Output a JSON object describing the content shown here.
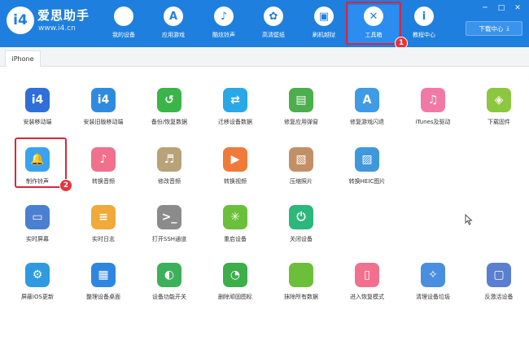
{
  "app": {
    "brand": "爱思助手",
    "url": "www.i4.cn",
    "logo_mark": "i4"
  },
  "nav": {
    "items": [
      {
        "label": "我的设备",
        "icon": "apple-icon",
        "glyph": ""
      },
      {
        "label": "应用游戏",
        "icon": "app-store-icon",
        "glyph": "A"
      },
      {
        "label": "酷炫铃声",
        "icon": "bell-icon",
        "glyph": "♪"
      },
      {
        "label": "高清壁纸",
        "icon": "flower-icon",
        "glyph": "✿"
      },
      {
        "label": "刷机越狱",
        "icon": "box-icon",
        "glyph": "▣"
      },
      {
        "label": "工具箱",
        "icon": "tools-icon",
        "glyph": "✕"
      },
      {
        "label": "教程中心",
        "icon": "info-icon",
        "glyph": "i"
      }
    ],
    "active_index": 5,
    "download_label": "下载中心",
    "download_glyph": "⤓"
  },
  "tabs": [
    {
      "label": "iPhone"
    }
  ],
  "annotations": {
    "badge_1": "1",
    "badge_2": "2"
  },
  "tools": [
    {
      "label": "安装移动端",
      "color": "#2f6fd8",
      "glyph": "i4"
    },
    {
      "label": "安装旧版移动端",
      "color": "#2f8be0",
      "glyph": "i4"
    },
    {
      "label": "备份/恢复数据",
      "color": "#3bb44a",
      "glyph": "↺"
    },
    {
      "label": "迁移设备数据",
      "color": "#29a8e8",
      "glyph": "⇄"
    },
    {
      "label": "修复应用弹窗",
      "color": "#4cae4c",
      "glyph": "▤"
    },
    {
      "label": "修复游戏闪退",
      "color": "#3f9be6",
      "glyph": "A"
    },
    {
      "label": "iTunes及驱动",
      "color": "#f07aa5",
      "glyph": "♫"
    },
    {
      "label": "下载固件",
      "color": "#8dc63f",
      "glyph": "◈"
    },
    {
      "label": "制作铃声",
      "color": "#3aa2ee",
      "glyph": "🔔"
    },
    {
      "label": "转换音频",
      "color": "#f0708e",
      "glyph": "♪"
    },
    {
      "label": "修改音频",
      "color": "#b8a27a",
      "glyph": "♬"
    },
    {
      "label": "转换视频",
      "color": "#f07a3a",
      "glyph": "▶"
    },
    {
      "label": "压缩照片",
      "color": "#c29066",
      "glyph": "▧"
    },
    {
      "label": "转换HEIC图片",
      "color": "#3f98dc",
      "glyph": "▨"
    },
    {
      "label": "实时屏幕",
      "color": "#4c7fd0",
      "glyph": "▭"
    },
    {
      "label": "实时日志",
      "color": "#f0a93a",
      "glyph": "≡"
    },
    {
      "label": "打开SSH通道",
      "color": "#8b8b8b",
      "glyph": ">_"
    },
    {
      "label": "重启设备",
      "color": "#6cbf3a",
      "glyph": "✳"
    },
    {
      "label": "关闭设备",
      "color": "#2cb87a",
      "glyph": "⏻"
    },
    {
      "label": "屏蔽iOS更新",
      "color": "#2f9ae0",
      "glyph": "⚙"
    },
    {
      "label": "整理设备桌面",
      "color": "#2f86e0",
      "glyph": "▦"
    },
    {
      "label": "设备功能开关",
      "color": "#3cb05a",
      "glyph": "◐"
    },
    {
      "label": "删除顽固图标",
      "color": "#3cae4a",
      "glyph": "◔"
    },
    {
      "label": "抹除所有数据",
      "color": "#6cbf3a",
      "glyph": ""
    },
    {
      "label": "进入恢复模式",
      "color": "#f0708e",
      "glyph": "▯"
    },
    {
      "label": "清理设备垃圾",
      "color": "#4a8ee0",
      "glyph": "✧"
    },
    {
      "label": "反激活设备",
      "color": "#5b7fd0",
      "glyph": "▢"
    }
  ]
}
